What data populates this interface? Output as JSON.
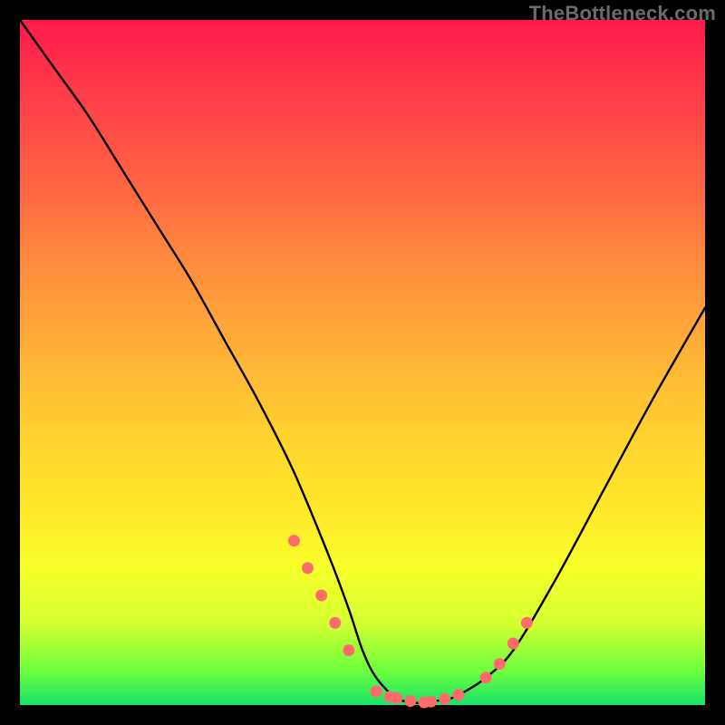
{
  "attribution": "TheBottleneck.com",
  "chart_data": {
    "type": "line",
    "title": "",
    "xlabel": "",
    "ylabel": "",
    "xlim": [
      0,
      100
    ],
    "ylim": [
      0,
      100
    ],
    "curve": {
      "x": [
        0,
        5,
        10,
        15,
        20,
        25,
        30,
        35,
        40,
        45,
        48,
        50,
        52,
        55,
        58,
        60,
        63,
        65,
        68,
        72,
        78,
        85,
        92,
        100
      ],
      "y": [
        100,
        93,
        86,
        78,
        70,
        62,
        53,
        44,
        34,
        22,
        14,
        8,
        4,
        1,
        0.3,
        0.5,
        1,
        2,
        4,
        8,
        18,
        31,
        44,
        58
      ]
    },
    "markers": {
      "x": [
        40,
        42,
        44,
        46,
        48,
        52,
        54,
        55,
        57,
        59,
        60,
        62,
        64,
        68,
        70,
        72,
        74
      ],
      "y": [
        24,
        20,
        16,
        12,
        8,
        2,
        1.2,
        1,
        0.6,
        0.4,
        0.5,
        0.9,
        1.5,
        4,
        6,
        9,
        12
      ]
    },
    "marker_color": "#ff6b6b",
    "curve_color": "#000000"
  }
}
